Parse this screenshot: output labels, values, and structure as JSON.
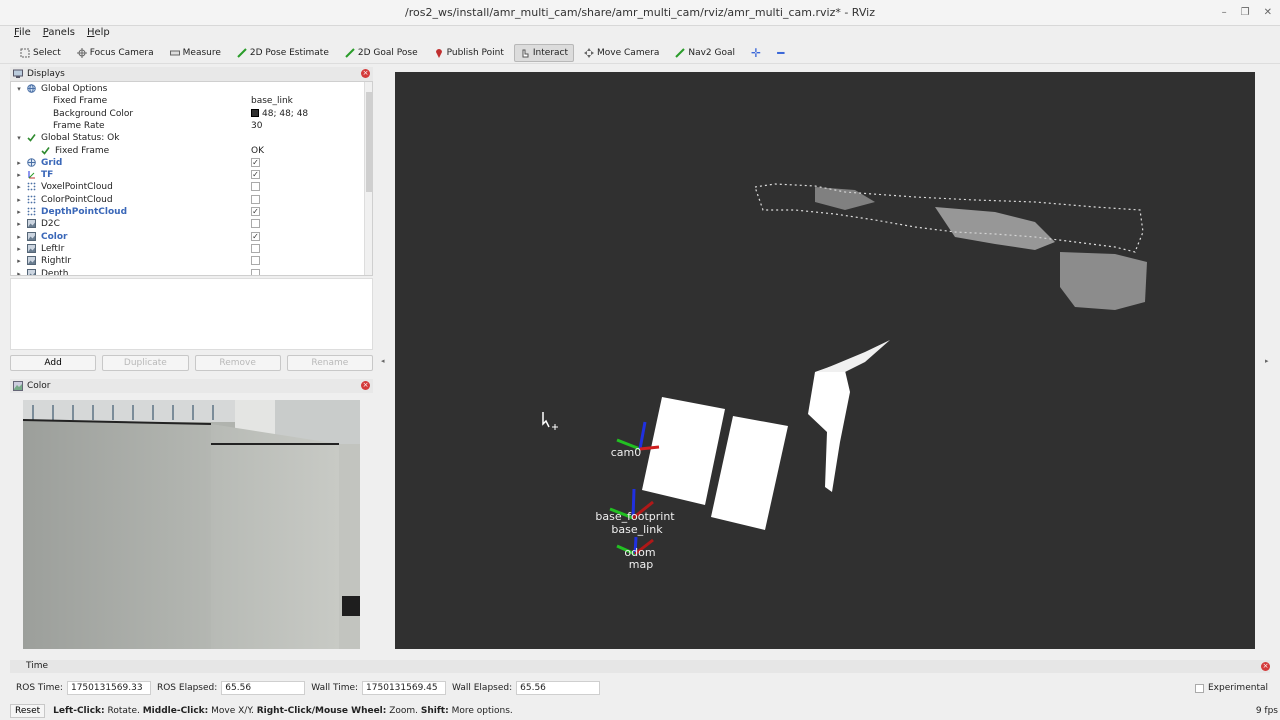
{
  "window": {
    "title": "/ros2_ws/install/amr_multi_cam/share/amr_multi_cam/rviz/amr_multi_cam.rviz* - RViz",
    "controls": [
      "–",
      "❐",
      "✕"
    ]
  },
  "menu": [
    "File",
    "Panels",
    "Help"
  ],
  "toolbar": [
    {
      "label": "Select",
      "icon": "select-icon"
    },
    {
      "label": "Focus Camera",
      "icon": "focus-camera-icon"
    },
    {
      "label": "Measure",
      "icon": "measure-icon"
    },
    {
      "label": "2D Pose Estimate",
      "icon": "pose-estimate-icon"
    },
    {
      "label": "2D Goal Pose",
      "icon": "goal-pose-icon"
    },
    {
      "label": "Publish Point",
      "icon": "publish-point-icon"
    },
    {
      "label": "Interact",
      "icon": "interact-icon",
      "active": true
    },
    {
      "label": "Move Camera",
      "icon": "move-camera-icon"
    },
    {
      "label": "Nav2 Goal",
      "icon": "nav2-goal-icon"
    }
  ],
  "displays_panel": {
    "title": "Displays",
    "rows": [
      {
        "label": "Global Options",
        "indent": 0,
        "expander": "▾",
        "icon": "globe"
      },
      {
        "label": "Fixed Frame",
        "indent": 1,
        "value": "base_link"
      },
      {
        "label": "Background Color",
        "indent": 1,
        "value": "48; 48; 48",
        "swatch": "#303030"
      },
      {
        "label": "Frame Rate",
        "indent": 1,
        "value": "30"
      },
      {
        "label": "Global Status: Ok",
        "indent": 0,
        "expander": "▾",
        "icon": "check"
      },
      {
        "label": "Fixed Frame",
        "indent": 1,
        "icon": "check",
        "value": "OK"
      },
      {
        "label": "Grid",
        "indent": 0,
        "expander": "▸",
        "icon": "grid",
        "checked": true,
        "bold": true
      },
      {
        "label": "TF",
        "indent": 0,
        "expander": "▸",
        "icon": "tf",
        "checked": true,
        "bold": true
      },
      {
        "label": "VoxelPointCloud",
        "indent": 0,
        "expander": "▸",
        "icon": "cloud",
        "checked": false
      },
      {
        "label": "ColorPointCloud",
        "indent": 0,
        "expander": "▸",
        "icon": "cloud",
        "checked": false
      },
      {
        "label": "DepthPointCloud",
        "indent": 0,
        "expander": "▸",
        "icon": "cloud",
        "checked": true,
        "bold": true
      },
      {
        "label": "D2C",
        "indent": 0,
        "expander": "▸",
        "icon": "image",
        "checked": false
      },
      {
        "label": "Color",
        "indent": 0,
        "expander": "▸",
        "icon": "image",
        "checked": true,
        "bold": true
      },
      {
        "label": "LeftIr",
        "indent": 0,
        "expander": "▸",
        "icon": "image",
        "checked": false
      },
      {
        "label": "RightIr",
        "indent": 0,
        "expander": "▸",
        "icon": "image",
        "checked": false
      },
      {
        "label": "Depth",
        "indent": 0,
        "expander": "▸",
        "icon": "image",
        "checked": false
      }
    ],
    "buttons": {
      "add": "Add",
      "duplicate": "Duplicate",
      "remove": "Remove",
      "rename": "Rename"
    }
  },
  "color_panel": {
    "title": "Color"
  },
  "tf_labels": [
    "cam0",
    "base_footprint",
    "base_link",
    "odom",
    "map"
  ],
  "time_panel": {
    "title": "Time",
    "ros_time_label": "ROS Time:",
    "ros_time": "1750131569.33",
    "ros_elapsed_label": "ROS Elapsed:",
    "ros_elapsed": "65.56",
    "wall_time_label": "Wall Time:",
    "wall_time": "1750131569.45",
    "wall_elapsed_label": "Wall Elapsed:",
    "wall_elapsed": "65.56",
    "experimental": "Experimental"
  },
  "status": {
    "reset": "Reset",
    "hint_parts": [
      {
        "b": "Left-Click:",
        "t": " Rotate. "
      },
      {
        "b": "Middle-Click:",
        "t": " Move X/Y. "
      },
      {
        "b": "Right-Click/Mouse Wheel:",
        "t": " Zoom. "
      },
      {
        "b": "Shift:",
        "t": " More options."
      }
    ],
    "fps": "9 fps"
  }
}
